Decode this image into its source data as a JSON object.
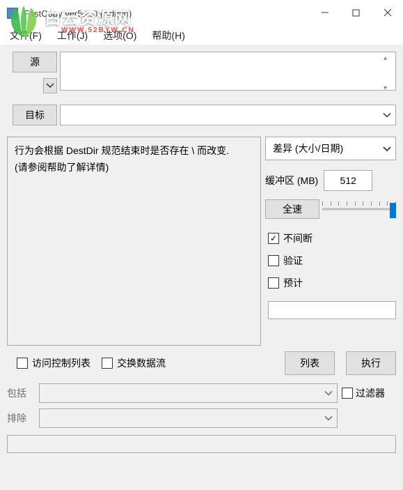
{
  "window": {
    "title": "FastCopy ver5.0.0 (Admin)"
  },
  "watermark": {
    "text": "白云资源网",
    "url": "WWW.52BYW.CN"
  },
  "menu": {
    "file": "文件(F)",
    "job": "工作(J)",
    "option": "选项(O)",
    "help": "帮助(H)"
  },
  "buttons": {
    "source": "源",
    "dest": "目标",
    "speed": "全速",
    "list": "列表",
    "execute": "执行"
  },
  "info": {
    "line1": "行为会根据 DestDir 规范结束时是否存在 \\ 而改变.",
    "line2": "(请参阅帮助了解详情)"
  },
  "mode": {
    "selected": "差异 (大小/日期)"
  },
  "buffer": {
    "label": "缓冲区 (MB)",
    "value": "512"
  },
  "checks": {
    "nonstop": "不间断",
    "verify": "验证",
    "estimate": "预计",
    "acl": "访问控制列表",
    "altstream": "交换数据流",
    "filter": "过滤器"
  },
  "filter": {
    "include_label": "包括",
    "exclude_label": "排除"
  }
}
